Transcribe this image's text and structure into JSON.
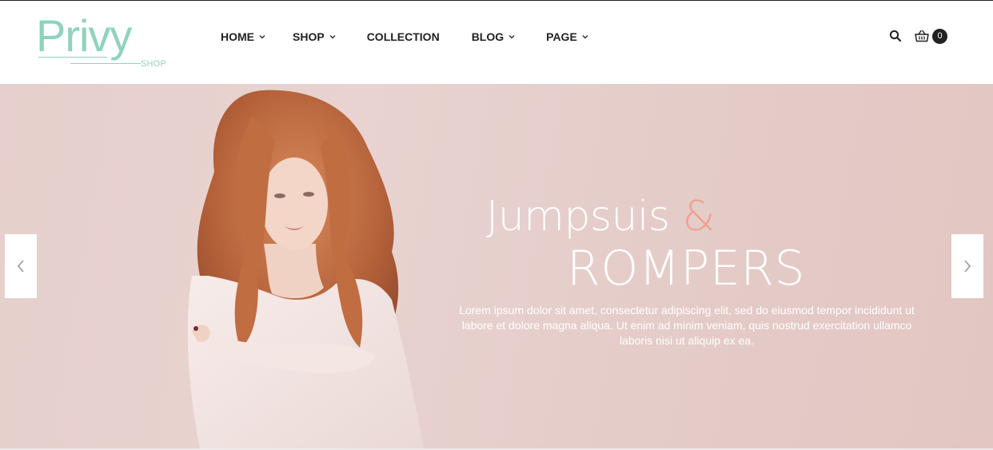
{
  "logo": {
    "text": "Privy",
    "subtext": "SHOP"
  },
  "nav": {
    "items": [
      {
        "label": "HOME",
        "dropdown": true
      },
      {
        "label": "SHOP",
        "dropdown": true
      },
      {
        "label": "COLLECTION",
        "dropdown": false
      },
      {
        "label": "BLOG",
        "dropdown": true
      },
      {
        "label": "PAGE",
        "dropdown": true
      }
    ]
  },
  "header": {
    "cart_count": "0"
  },
  "hero": {
    "title_line1": "Jumpsuis",
    "title_amp": "&",
    "title_line2": "ROMPERS",
    "description": "Lorem ipsum dolor sit amet, consectetur adipiscing elit, sed do eiusmod tempor incididunt ut labore et dolore magna aliqua. Ut enim ad minim veniam, quis nostrud exercitation ullamco laboris nisi ut aliquip ex ea."
  },
  "colors": {
    "brand": "#8fd3bd",
    "accent": "#f0a08e",
    "hero_bg": "#e6cfcc",
    "text_dark": "#222222"
  },
  "icons": {
    "search": "search-icon",
    "cart": "basket-icon",
    "prev": "chevron-left-icon",
    "next": "chevron-right-icon",
    "dropdown": "chevron-down-icon"
  }
}
